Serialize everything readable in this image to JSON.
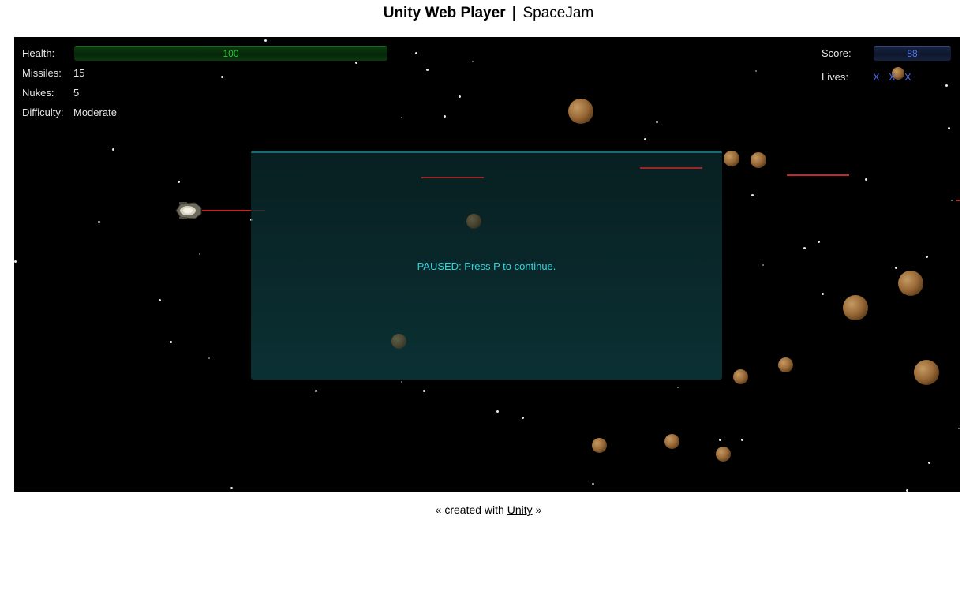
{
  "page": {
    "title_bold": "Unity Web Player",
    "title_separator": "|",
    "title_rest": "SpaceJam"
  },
  "hud": {
    "health_label": "Health:",
    "health_value": "100",
    "health_fraction": 1.0,
    "missiles_label": "Missiles:",
    "missiles_value": "15",
    "nukes_label": "Nukes:",
    "nukes_value": "5",
    "difficulty_label": "Difficulty:",
    "difficulty_value": "Moderate",
    "score_label": "Score:",
    "score_value": "88",
    "lives_label": "Lives:",
    "lives_marks": [
      "X",
      "X",
      "X"
    ]
  },
  "pause": {
    "message": "PAUSED: Press P to continue."
  },
  "footer": {
    "prefix": "« created with",
    "link": "Unity",
    "suffix": "»"
  },
  "colors": {
    "health_text": "#22cc33",
    "score_text": "#5577ee",
    "lives_text": "#4466ee",
    "pause_text": "#33d6e0",
    "laser": "#c0282c"
  }
}
